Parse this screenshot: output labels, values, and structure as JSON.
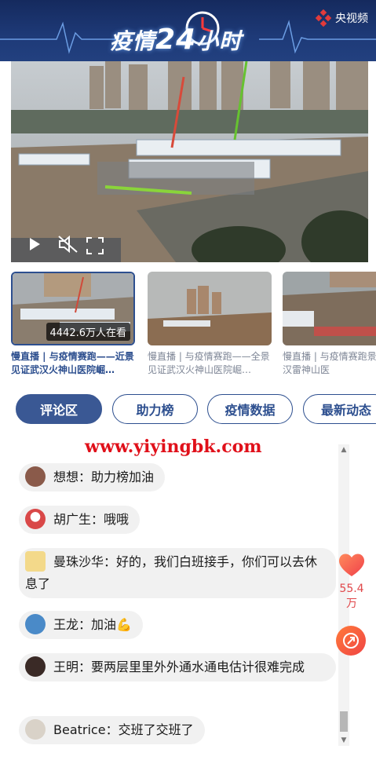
{
  "header": {
    "title_a": "疫情",
    "title_num": "24",
    "title_b": "小时",
    "brand": "央视频"
  },
  "video": {
    "play_icon": "play-icon",
    "mute_icon": "mute-icon",
    "fullscreen_icon": "fullscreen-icon"
  },
  "thumbnails": [
    {
      "caption": "慢直播 | 与疫情赛跑——近景见证武汉火神山医院崛…",
      "viewers": "4442.6万人在看",
      "active": true
    },
    {
      "caption": "慢直播 | 与疫情赛跑——全景见证武汉火神山医院崛…",
      "active": false
    },
    {
      "caption": "慢直播 | 与疫情赛跑景直击武汉雷神山医",
      "active": false
    }
  ],
  "tabs": [
    {
      "label": "评论区",
      "active": true
    },
    {
      "label": "助力榜",
      "active": false
    },
    {
      "label": "疫情数据",
      "active": false
    },
    {
      "label": "最新动态",
      "active": false
    }
  ],
  "watermark": "www.yiyingbk.com",
  "comments": [
    {
      "name": "想想",
      "sep": "：",
      "text": "助力榜加油"
    },
    {
      "name": "胡广生",
      "sep": "：",
      "text": "哦哦"
    },
    {
      "name": "曼珠沙华",
      "sep": "：",
      "text": "好的，我们白班接手，你们可以去休息了"
    },
    {
      "name": "王龙",
      "sep": "：",
      "text": "加油💪"
    },
    {
      "name": "王明",
      "sep": "：",
      "text": "要两层里里外外通水通电估计很难完成"
    },
    {
      "name": "Beatrice",
      "sep": "：",
      "text": "交班了交班了"
    }
  ],
  "side": {
    "like_count": "55.4万"
  },
  "colors": {
    "brand_blue": "#2d4f8f",
    "like_red": "#e0474a",
    "watermark_red": "#e0101a"
  }
}
